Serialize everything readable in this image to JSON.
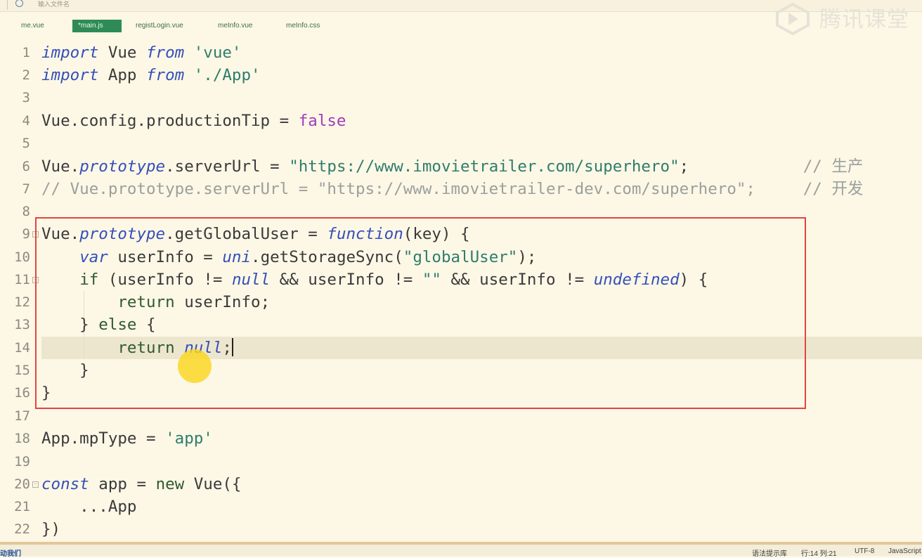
{
  "search": {
    "placeholder": "输入文件名"
  },
  "tabs": [
    {
      "label": "me.vue",
      "active": false
    },
    {
      "label": "*main.js",
      "active": true
    },
    {
      "label": "registLogin.vue",
      "active": false
    },
    {
      "label": "meInfo.vue",
      "active": false
    },
    {
      "label": "meInfo.css",
      "active": false
    }
  ],
  "watermark": {
    "text": "腾讯课堂"
  },
  "editor": {
    "line_numbers": [
      "1",
      "2",
      "3",
      "4",
      "5",
      "6",
      "7",
      "8",
      "9",
      "10",
      "11",
      "12",
      "13",
      "14",
      "15",
      "16",
      "17",
      "18",
      "19",
      "20",
      "21",
      "22"
    ],
    "current_line": 14,
    "highlighted_range": [
      9,
      16
    ]
  },
  "status": {
    "left": "动我们",
    "lint": "语法提示库",
    "position": "行:14  列:21",
    "encoding": "UTF-8",
    "language": "JavaScript"
  },
  "colors": {
    "keyword": "#3450b8",
    "string": "#2e7d6b",
    "boolean": "#a13dba",
    "comment": "#9aa09c",
    "highlight_box": "#e1453f",
    "active_tab": "#2e8b57"
  }
}
